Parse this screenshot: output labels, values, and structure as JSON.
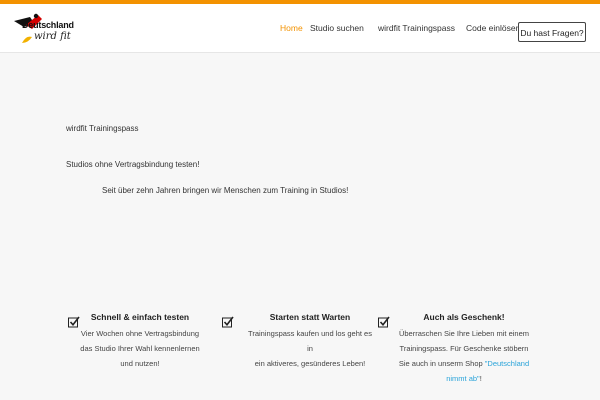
{
  "header": {
    "logo": {
      "line1": "Deutschland",
      "line2": "wird fit"
    },
    "nav": [
      {
        "label": "Home",
        "active": true
      },
      {
        "label": "Studio suchen",
        "active": false
      },
      {
        "label": "wirdfit Trainingspass",
        "active": false
      },
      {
        "label": "Code einlösen",
        "active": false
      }
    ],
    "cta_label": "Du hast Fragen?"
  },
  "main": {
    "kicker": "wirdfit Trainingspass",
    "headline": "Studios ohne Vertragsbindung testen!",
    "subline": "Seit über zehn Jahren bringen wir Menschen zum Training in Studios!"
  },
  "features": [
    {
      "title": "Schnell & einfach testen",
      "lines": [
        "Vier Wochen ohne Vertragsbindung",
        "das Studio Ihrer Wahl kennenlernen",
        "und nutzen!"
      ]
    },
    {
      "title": "Starten statt Warten",
      "lines": [
        "Trainingspass kaufen und los geht es in",
        "ein aktiveres, gesünderes Leben!"
      ]
    },
    {
      "title": "Auch als Geschenk!",
      "lines": [
        "Überraschen Sie Ihre Lieben mit einem",
        "Trainingspass. Für Geschenke stöbern",
        "Sie auch in unserm Shop"
      ],
      "link_label": "\"Deutschland",
      "link_label2": "nimmt ab\"",
      "after_link": "!"
    }
  ],
  "colors": {
    "accent": "#f39200",
    "link": "#29a3d9",
    "background": "#f7f7f7"
  },
  "icons": {
    "feature_icon": "checkbox-check-icon"
  }
}
